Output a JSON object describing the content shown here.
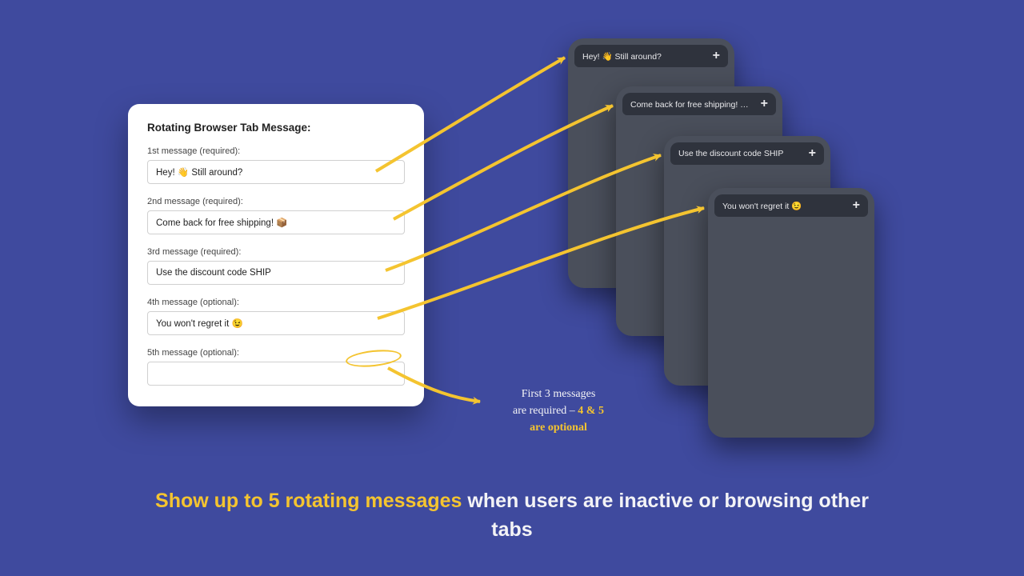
{
  "form": {
    "title": "Rotating Browser Tab Message:",
    "fields": [
      {
        "label": "1st message (required):",
        "value": "Hey! 👋 Still around?"
      },
      {
        "label": "2nd message (required):",
        "value": "Come back for free shipping! 📦"
      },
      {
        "label": "3rd message (required):",
        "value": "Use the discount code SHIP"
      },
      {
        "label": "4th message (optional):",
        "value": "You won't regret it 😉"
      },
      {
        "label": "5th message (optional):",
        "value": ""
      }
    ]
  },
  "phones": [
    {
      "tab": "Hey! 👋 Still around?"
    },
    {
      "tab": "Come back for free shipping! 📦"
    },
    {
      "tab": "Use the discount code SHIP"
    },
    {
      "tab": "You won't regret it 😉"
    }
  ],
  "note": {
    "line1": "First 3 messages",
    "line2a": "are required – ",
    "line2b": "4 & 5",
    "line3": "are optional"
  },
  "headline": {
    "part1": "Show up to 5 rotating messages ",
    "part2": "when users are inactive or browsing other tabs"
  },
  "icons": {
    "plus": "+"
  }
}
